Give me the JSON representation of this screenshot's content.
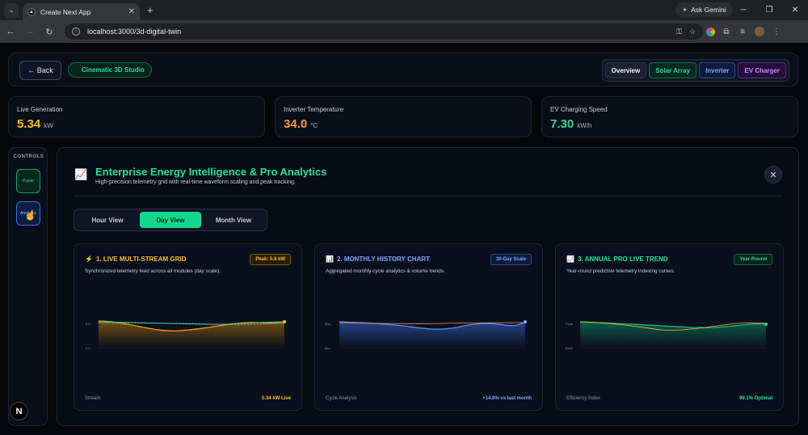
{
  "browser": {
    "tab_title": "Create Next App",
    "url": "localhost:3000/3d-digital-twin",
    "ask_gemini": "Ask Gemini"
  },
  "header": {
    "back_label": "← Back",
    "studio_badge": "Cinematic 3D Studio",
    "views": [
      "Overview",
      "Solar Array",
      "Inverter",
      "EV Charger"
    ]
  },
  "stats": [
    {
      "label": "Live Generation",
      "value": "5.34",
      "unit": "kW",
      "color": "#fbbf24"
    },
    {
      "label": "Inverter Temperature",
      "value": "34.0",
      "unit": "°C",
      "color": "#fb923c"
    },
    {
      "label": "EV Charging Speed",
      "value": "7.30",
      "unit": "kW/h",
      "color": "#34d399"
    }
  ],
  "controls": {
    "title": "CONTROLS",
    "power": "Power",
    "analytics": "Analytics"
  },
  "panel": {
    "icon": "📈",
    "title": "Enterprise Energy Intelligence & Pro Analytics",
    "subtitle": "High-precision telemetry grid with real-time waveform scaling and peak tracking.",
    "close": "✕",
    "ranges": [
      "Hour View",
      "Day View",
      "Month View"
    ],
    "active_range": "Day View"
  },
  "cards": [
    {
      "icon": "⚡",
      "title": "1. LIVE MULTI-STREAM GRID",
      "badge": "Peak: 5.8 kW",
      "desc": "Synchronized telemetry feed across all modules (day scale).",
      "foot_left": "Stream",
      "foot_right": "5.34 kW Live",
      "title_color": "#fbbf24",
      "y_labels": [
        "6.8",
        "0.0"
      ]
    },
    {
      "icon": "📊",
      "title": "2. MONTHLY HISTORY CHART",
      "badge": "30-Day Scale",
      "desc": "Aggregated monthly cycle analytics & volume trends.",
      "foot_left": "Cycle Analysis",
      "foot_right": "+14.8% vs last month",
      "title_color": "#7aa7ff",
      "y_labels": [
        "Max",
        "Min"
      ]
    },
    {
      "icon": "📈",
      "title": "3. ANNUAL PRO LIVE TREND",
      "badge": "Year-Round",
      "desc": "Year-round predictive telemetry indexing curves.",
      "foot_left": "Efficiency Index",
      "foot_right": "99.1% Optimal",
      "title_color": "#22e39b",
      "y_labels": [
        "Peak",
        "Base"
      ]
    }
  ]
}
